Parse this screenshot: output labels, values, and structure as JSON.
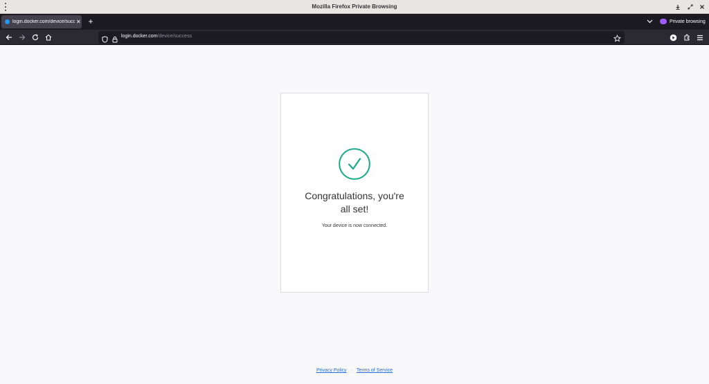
{
  "window": {
    "title": "Mozilla Firefox Private Browsing"
  },
  "tabs": [
    {
      "title": "login.docker.com/device/success",
      "active": true
    }
  ],
  "private_badge": {
    "label": "Private browsing",
    "color": "#a15cff"
  },
  "address_bar": {
    "domain": "login.docker.com",
    "path": "/device/success"
  },
  "page": {
    "headline": "Congratulations, you're all set!",
    "message": "Your device is now connected.",
    "success_color": "#1aaa8a",
    "footer": {
      "privacy_label": "Privacy Policy",
      "separator": "·",
      "terms_label": "Terms of Service"
    }
  },
  "icons": [
    "menu-dots-icon",
    "minimize-icon",
    "maximize-icon",
    "close-icon",
    "back-icon",
    "forward-icon",
    "reload-icon",
    "home-icon",
    "shield-icon",
    "lock-icon",
    "star-icon",
    "extension-icon",
    "bookmarks-icon",
    "hamburger-menu-icon",
    "checkmark-icon"
  ]
}
